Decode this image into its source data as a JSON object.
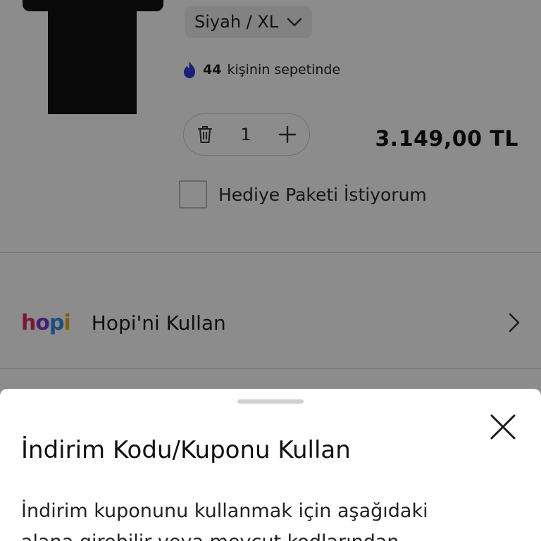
{
  "product": {
    "variant_label": "Siyah / XL",
    "popularity": {
      "count": "44",
      "text": "kişinin sepetinde"
    },
    "quantity": "1",
    "price": "3.149,00 TL",
    "gift_label": "Hediye Paketi İstiyorum"
  },
  "hopi": {
    "logo": {
      "h": "h",
      "o": "o",
      "p": "p",
      "i": "i"
    },
    "label": "Hopi'ni Kullan"
  },
  "sheet": {
    "title": "İndirim Kodu/Kuponu Kullan",
    "description": "İndirim kuponunu kullanmak için aşağıdaki alana girebilir veya mevcut kodlarından"
  },
  "icons": {
    "flame": "flame-icon",
    "trash": "trash-icon",
    "plus": "plus-icon",
    "chevron_down": "chevron-down-icon",
    "chevron_right": "chevron-right-icon",
    "close": "close-icon"
  },
  "colors": {
    "flame": "#2e3bd6",
    "overlay": "rgba(0,0,0,0.45)",
    "hopi_h": "#e4285a",
    "hopi_o": "#7a3fd1",
    "hopi_p": "#2f8fe8",
    "hopi_i": "#f6a31b"
  }
}
